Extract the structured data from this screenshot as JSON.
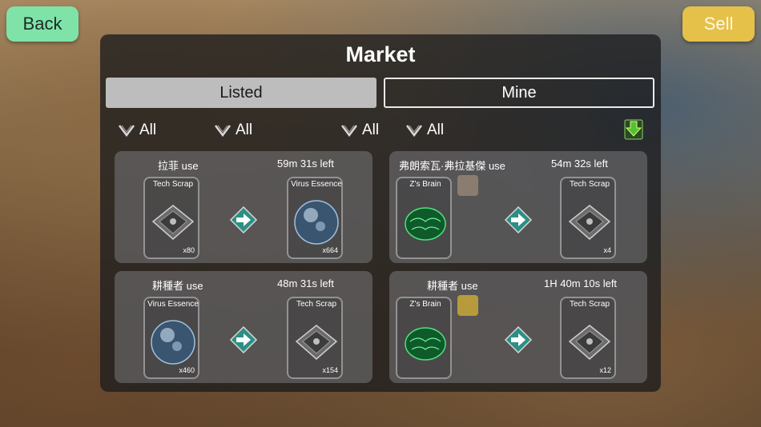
{
  "top_bar": {
    "back_label": "Back",
    "sell_label": "Sell"
  },
  "market": {
    "title": "Market",
    "tabs": [
      {
        "label": "Listed",
        "selected": true
      },
      {
        "label": "Mine",
        "selected": false
      }
    ],
    "filters": [
      {
        "label": "All"
      },
      {
        "label": "All"
      },
      {
        "label": "All"
      },
      {
        "label": "All"
      }
    ],
    "download_icon": "download-arrow-icon",
    "listings": [
      {
        "user": "拉菲 use",
        "time_left": "59m 31s left",
        "give": {
          "name": "Tech Scrap",
          "qty": "x80",
          "icon": "tech-scrap-icon"
        },
        "get": {
          "name": "Virus Essence",
          "qty": "x664",
          "icon": "virus-essence-icon"
        }
      },
      {
        "user": "弗朗索瓦·弗拉基傑 use",
        "time_left": "54m 32s left",
        "avatar": "character-avatar-icon",
        "give": {
          "name": "Z's Brain",
          "qty": "",
          "icon": "zs-brain-icon"
        },
        "get": {
          "name": "Tech Scrap",
          "qty": "x4",
          "icon": "tech-scrap-icon"
        }
      },
      {
        "user": "耕種者 use",
        "time_left": "48m 31s left",
        "give": {
          "name": "Virus Essence",
          "qty": "x460",
          "icon": "virus-essence-icon"
        },
        "get": {
          "name": "Tech Scrap",
          "qty": "x154",
          "icon": "tech-scrap-icon"
        }
      },
      {
        "user": "耕種者 use",
        "time_left": "1H 40m 10s left",
        "avatar": "farmland-avatar-icon",
        "give": {
          "name": "Z's Brain",
          "qty": "",
          "icon": "zs-brain-icon"
        },
        "get": {
          "name": "Tech Scrap",
          "qty": "x12",
          "icon": "tech-scrap-icon"
        }
      }
    ]
  },
  "colors": {
    "back_button": "#7fe3a8",
    "sell_button": "#e6c14a",
    "arrow": "#3fb2a0",
    "download": "#52c234"
  }
}
